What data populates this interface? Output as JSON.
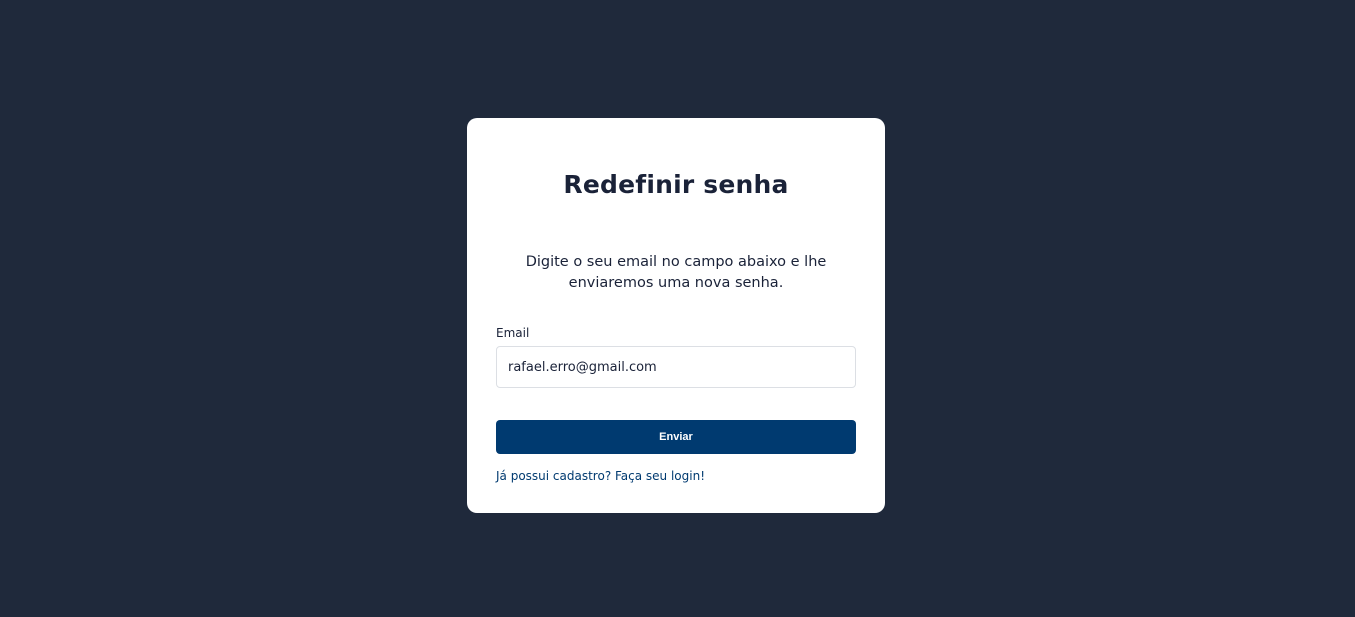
{
  "card": {
    "title": "Redefinir senha",
    "description": "Digite o seu email no campo abaixo e lhe enviaremos uma nova senha.",
    "email_label": "Email",
    "email_value": "rafael.erro@gmail.com",
    "submit_label": "Enviar",
    "login_link": "Já possui cadastro? Faça seu login!"
  },
  "colors": {
    "background": "#1f293b",
    "card": "#ffffff",
    "primary": "#003a70",
    "text": "#1a2238"
  }
}
